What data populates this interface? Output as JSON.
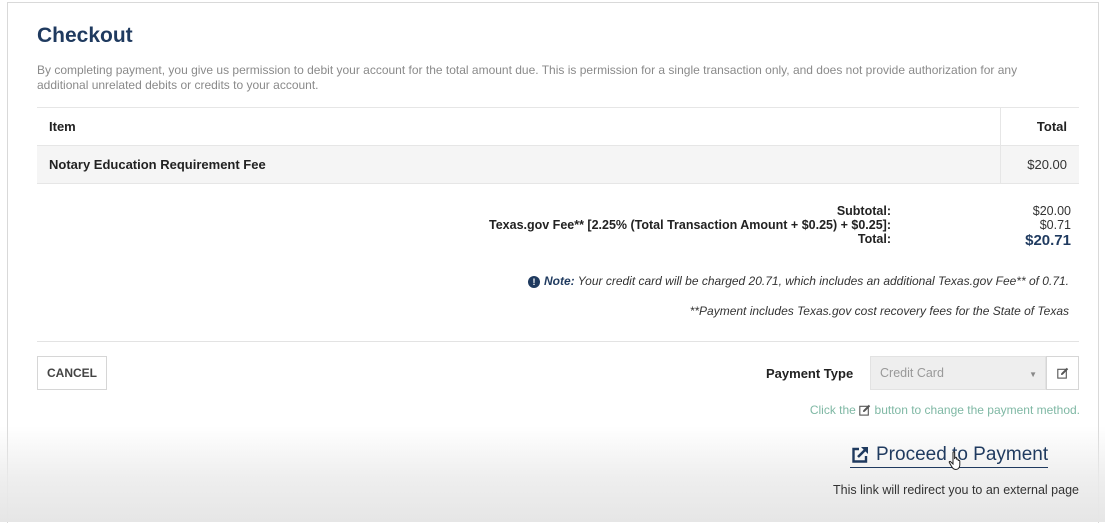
{
  "checkout": {
    "title": "Checkout",
    "intro": "By completing payment, you give us permission to debit your account for the total amount due.  This is permission for a single transaction only, and does not provide authorization for any additional unrelated debits or credits to your account."
  },
  "table": {
    "headers": {
      "item": "Item",
      "total": "Total"
    },
    "rows": [
      {
        "item": "Notary Education Requirement Fee",
        "total": "$20.00"
      }
    ]
  },
  "summary": {
    "subtotal_label": "Subtotal:",
    "subtotal_value": "$20.00",
    "fee_label": "Texas.gov Fee** [2.25% (Total Transaction Amount + $0.25) + $0.25]:",
    "fee_value": "$0.71",
    "total_label": "Total:",
    "total_value": "$20.71"
  },
  "note": {
    "label": "Note:",
    "text": " Your credit card will be charged 20.71, which includes an additional Texas.gov Fee** of 0.71.",
    "footnote": "**Payment includes Texas.gov cost recovery fees for the State of Texas"
  },
  "actions": {
    "cancel_label": "CANCEL",
    "payment_type_label": "Payment Type",
    "payment_type_value": "Credit Card",
    "hint_prefix": "Click the ",
    "hint_suffix": " button to change the payment method.",
    "proceed_label": "Proceed to Payment",
    "redirect_text": "This link will redirect you to an external page"
  },
  "icons": {
    "info": "info-circle-icon",
    "edit": "edit-pencil-icon",
    "external": "external-link-icon",
    "caret": "caret-down-icon",
    "cursor": "hand-pointer-icon"
  },
  "colors": {
    "heading": "#1f3a5f",
    "hint": "#7fb8a4",
    "muted": "#8a8a8a"
  }
}
